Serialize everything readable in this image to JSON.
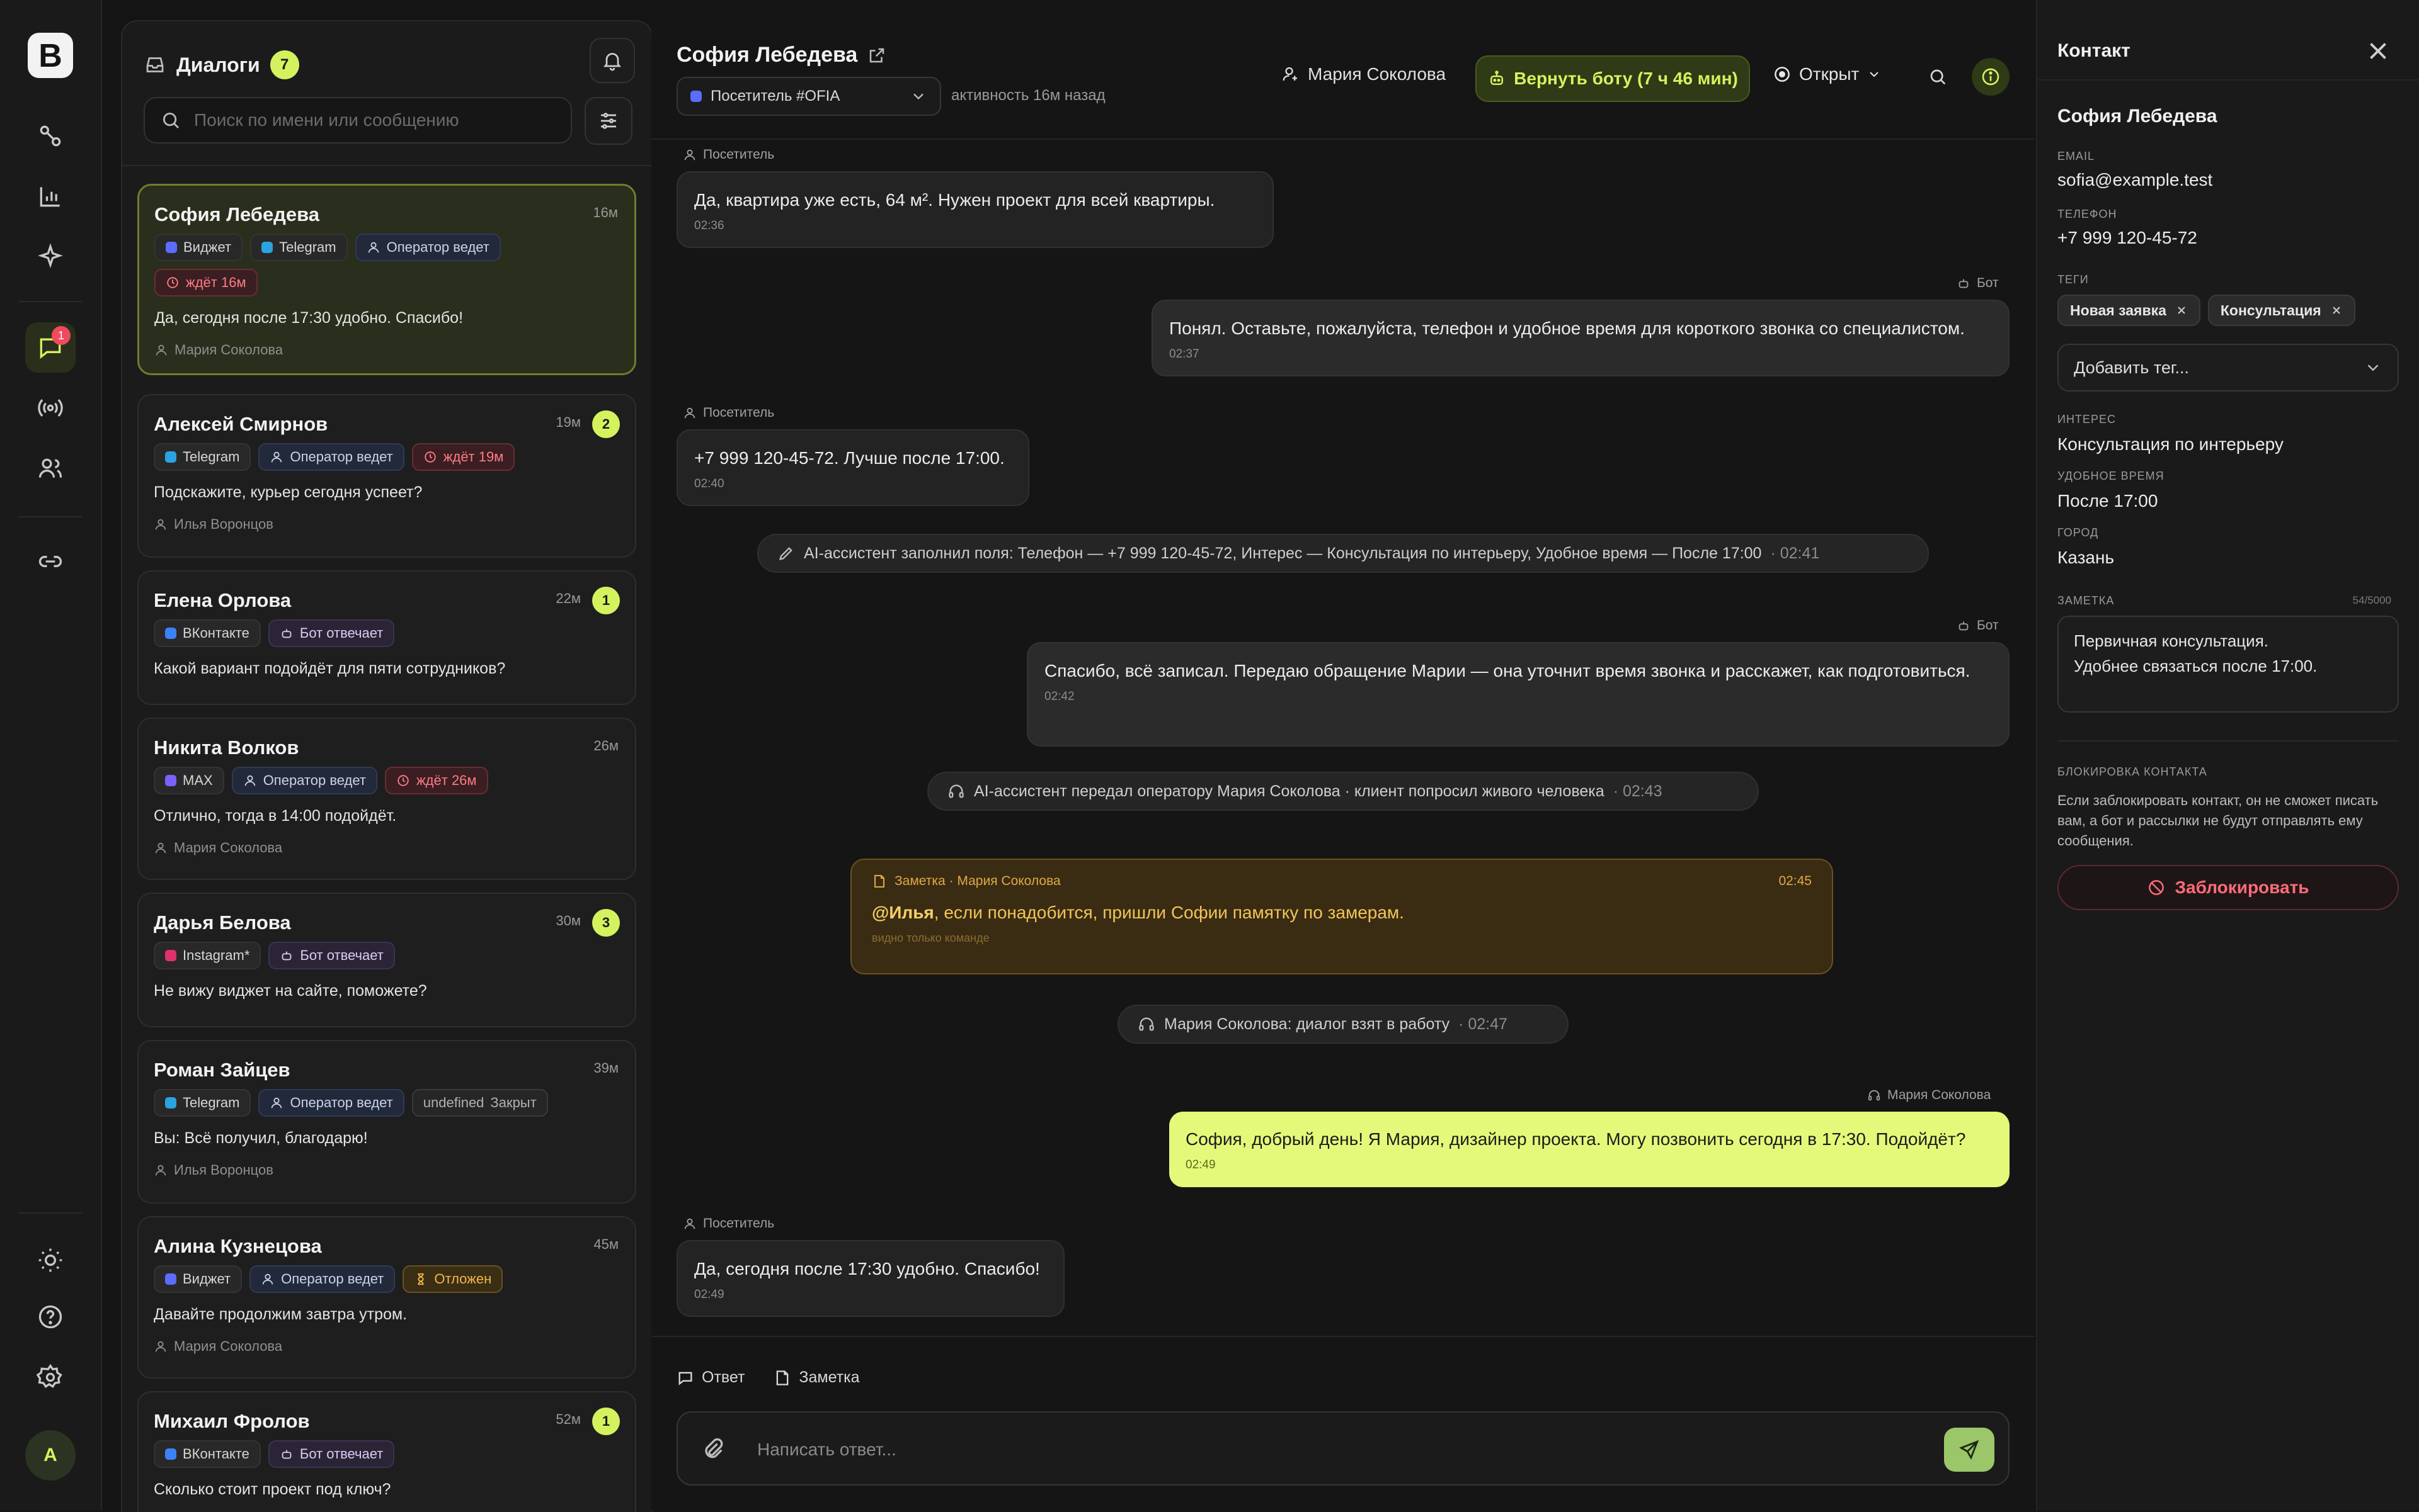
{
  "rail": {
    "logo_letter": "B",
    "chat_badge": "1",
    "avatar_letter": "A"
  },
  "dialogs": {
    "title": "Диалоги",
    "count": "7",
    "search_placeholder": "Поиск по имени или сообщению",
    "items": [
      {
        "name": "София Лебедева",
        "time": "16м",
        "unread": "",
        "tags": [
          {
            "kind": "channel",
            "label": "Виджет",
            "color": "#5b6cff"
          },
          {
            "kind": "channel",
            "label": "Telegram",
            "color": "#2aa3e0"
          },
          {
            "kind": "operator",
            "label": "Оператор ведет"
          },
          {
            "kind": "wait",
            "label": "ждёт 16м"
          }
        ],
        "message": "Да, сегодня после 17:30 удобно. Спасибо!",
        "agent": "Мария Соколова"
      },
      {
        "name": "Алексей Смирнов",
        "time": "19м",
        "unread": "2",
        "tags": [
          {
            "kind": "channel",
            "label": "Telegram",
            "color": "#2aa3e0"
          },
          {
            "kind": "operator",
            "label": "Оператор ведет"
          },
          {
            "kind": "wait",
            "label": "ждёт 19м"
          }
        ],
        "message": "Подскажите, курьер сегодня успеет?",
        "agent": "Илья Воронцов"
      },
      {
        "name": "Елена Орлова",
        "time": "22м",
        "unread": "1",
        "tags": [
          {
            "kind": "channel",
            "label": "ВКонтакте",
            "color": "#3b82f6"
          },
          {
            "kind": "bot",
            "label": "Бот отвечает"
          }
        ],
        "message": "Какой вариант подойдёт для пяти сотрудников?",
        "agent": ""
      },
      {
        "name": "Никита Волков",
        "time": "26м",
        "unread": "",
        "tags": [
          {
            "kind": "channel",
            "label": "MAX",
            "color": "#7b61ff"
          },
          {
            "kind": "operator",
            "label": "Оператор ведет"
          },
          {
            "kind": "wait",
            "label": "ждёт 26м"
          }
        ],
        "message": "Отлично, тогда в 14:00 подойдёт.",
        "agent": "Мария Соколова"
      },
      {
        "name": "Дарья Белова",
        "time": "30м",
        "unread": "3",
        "tags": [
          {
            "kind": "channel",
            "label": "Instagram*",
            "color": "#e1306c"
          },
          {
            "kind": "bot",
            "label": "Бот отвечает"
          }
        ],
        "message": "Не вижу виджет на сайте, поможете?",
        "agent": ""
      },
      {
        "name": "Роман Зайцев",
        "time": "39м",
        "unread": "",
        "tags": [
          {
            "kind": "channel",
            "label": "Telegram",
            "color": "#2aa3e0"
          },
          {
            "kind": "operator",
            "label": "Оператор ведет"
          },
          {
            "kind": "closed",
            "label": "Закрыт"
          }
        ],
        "message": "Вы: Всё получил, благодарю!",
        "agent": "Илья Воронцов"
      },
      {
        "name": "Алина Кузнецова",
        "time": "45м",
        "unread": "",
        "tags": [
          {
            "kind": "channel",
            "label": "Виджет",
            "color": "#5b6cff"
          },
          {
            "kind": "operator",
            "label": "Оператор ведет"
          },
          {
            "kind": "delayed",
            "label": "Отложен"
          }
        ],
        "message": "Давайте продолжим завтра утром.",
        "agent": "Мария Соколова"
      },
      {
        "name": "Михаил Фролов",
        "time": "52м",
        "unread": "1",
        "tags": [
          {
            "kind": "channel",
            "label": "ВКонтакте",
            "color": "#3b82f6"
          },
          {
            "kind": "bot",
            "label": "Бот отвечает"
          }
        ],
        "message": "Сколько стоит проект под ключ?",
        "agent": ""
      }
    ]
  },
  "chat": {
    "name": "София Лебедева",
    "source": "Посетитель #OFIA",
    "activity": "активность 16м назад",
    "assignee": "Мария Соколова",
    "return_bot": "Вернуть боту (7 ч 46 мин)",
    "status": "Открыт",
    "m1": {
      "label": "Посетитель",
      "text": "Да, квартира уже есть, 64 м². Нужен проект для всей квартиры.",
      "time": "02:36"
    },
    "m2": {
      "label": "Бот",
      "text": "Понял. Оставьте, пожалуйста, телефон и удобное время для короткого звонка со специалистом.",
      "time": "02:37"
    },
    "m3": {
      "label": "Посетитель",
      "text": "+7 999 120-45-72. Лучше после 17:00.",
      "time": "02:40"
    },
    "s1": {
      "text": "AI-ассистент заполнил поля: Телефон — +7 999 120-45-72, Интерес — Консультация по интерьеру, Удобное время — После 17:00",
      "time": "· 02:41"
    },
    "m4": {
      "label": "Бот",
      "text": "Спасибо, всё записал. Передаю обращение Марии — она уточнит время звонка и расскажет, как подготовиться.",
      "time": "02:42"
    },
    "s2": {
      "text": "AI-ассистент передал оператору Мария Соколова · клиент попросил живого человека",
      "time": "· 02:43"
    },
    "note": {
      "header": "Заметка · Мария Соколова",
      "time": "02:45",
      "mention": "@Илья",
      "text": ", если понадобится, пришли Софии памятку по замерам.",
      "footer": "видно только команде"
    },
    "s3": {
      "text": "Мария Соколова: диалог взят в работу",
      "time": "· 02:47"
    },
    "m5": {
      "label": "Мария Соколова",
      "text": "София, добрый день! Я Мария, дизайнер проекта. Могу позвонить сегодня в 17:30. Подойдёт?",
      "time": "02:49"
    },
    "m6": {
      "label": "Посетитель",
      "text": "Да, сегодня после 17:30 удобно. Спасибо!",
      "time": "02:49"
    },
    "tab_reply": "Ответ",
    "tab_note": "Заметка",
    "input_placeholder": "Написать ответ..."
  },
  "contact": {
    "title": "Контакт",
    "name": "София Лебедева",
    "email_label": "Email",
    "email": "sofia@example.test",
    "phone_label": "Телефон",
    "phone": "+7 999 120-45-72",
    "tags_label": "Теги",
    "tags": [
      "Новая заявка",
      "Консультация"
    ],
    "add_tag": "Добавить тег...",
    "interest_label": "Интерес",
    "interest": "Консультация по интерьеру",
    "time_label": "Удобное время",
    "time": "После 17:00",
    "city_label": "Город",
    "city": "Казань",
    "note_label": "Заметка",
    "note_count": "54/5000",
    "note": "Первичная консультация.\nУдобнее связаться после 17:00.",
    "block_label": "Блокировка контакта",
    "block_text": "Если заблокировать контакт, он не сможет писать вам, а бот и рассылки не будут отправлять ему сообщения.",
    "block_button": "Заблокировать"
  },
  "colors": {
    "accent": "#d4f25e",
    "danger": "#ff6b78",
    "note": "#f2c45a"
  }
}
